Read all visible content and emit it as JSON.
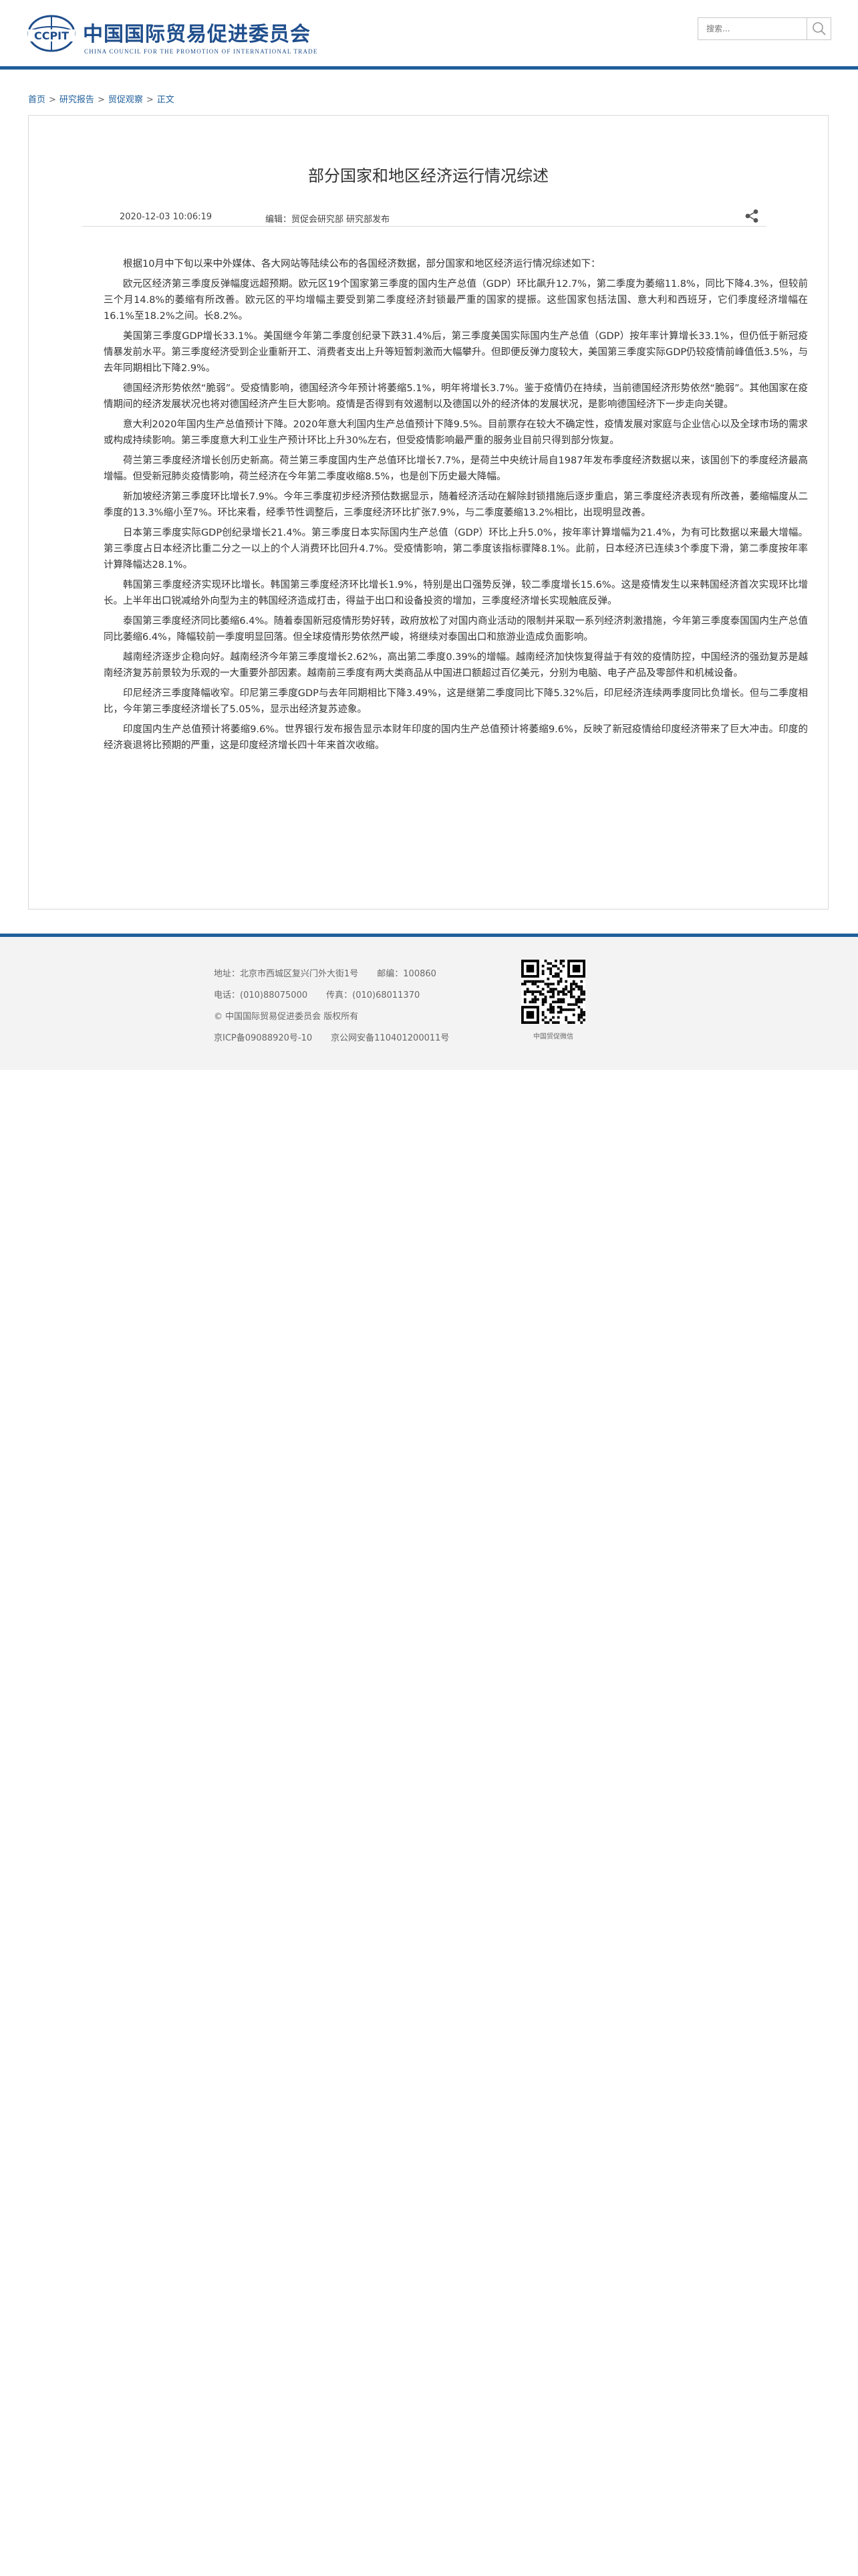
{
  "header": {
    "logo": {
      "mark_text": "CCPIT",
      "name_cn": "中国国际贸易促进委员会",
      "name_en": "CHINA COUNCIL FOR THE PROMOTION OF INTERNATIONAL TRADE"
    },
    "search": {
      "placeholder": "搜索...",
      "icon": "search-icon"
    },
    "accent_color": "#1f5f9b"
  },
  "breadcrumb": {
    "items": [
      "首页",
      "研究报告",
      "贸促观察",
      "正文"
    ],
    "separator": ">"
  },
  "article": {
    "title": "部分国家和地区经济运行情况综述",
    "date": "2020-12-03 10:06:19",
    "editor": "编辑：贸促会研究部 研究部发布",
    "share_icon": "share-icon",
    "paragraphs": [
      "根据10月中下旬以来中外媒体、各大网站等陆续公布的各国经济数据，部分国家和地区经济运行情况综述如下：",
      "欧元区经济第三季度反弹幅度远超预期。欧元区19个国家第三季度的国内生产总值（GDP）环比飙升12.7%，第二季度为萎缩11.8%，同比下降4.3%，但较前三个月14.8%的萎缩有所改善。欧元区的平均增幅主要受到第二季度经济封锁最严重的国家的提振。这些国家包括法国、意大利和西班牙，它们季度经济增幅在16.1%至18.2%之间。长8.2%。",
      "美国第三季度GDP增长33.1%。美国继今年第二季度创纪录下跌31.4%后，第三季度美国实际国内生产总值（GDP）按年率计算增长33.1%，但仍低于新冠疫情暴发前水平。第三季度经济受到企业重新开工、消费者支出上升等短暂刺激而大幅攀升。但即便反弹力度较大，美国第三季度实际GDP仍较疫情前峰值低3.5%，与去年同期相比下降2.9%。",
      "德国经济形势依然“脆弱”。受疫情影响，德国经济今年预计将萎缩5.1%，明年将增长3.7%。鉴于疫情仍在持续，当前德国经济形势依然“脆弱”。其他国家在疫情期间的经济发展状况也将对德国经济产生巨大影响。疫情是否得到有效遏制以及德国以外的经济体的发展状况，是影响德国经济下一步走向关键。",
      "意大利2020年国内生产总值预计下降。2020年意大利国内生产总值预计下降9.5%。目前票存在较大不确定性，疫情发展对家庭与企业信心以及全球市场的需求或构成持续影响。第三季度意大利工业生产预计环比上升30%左右，但受疫情影响最严重的服务业目前只得到部分恢复。",
      "荷兰第三季度经济增长创历史新高。荷兰第三季度国内生产总值环比增长7.7%，是荷兰中央统计局自1987年发布季度经济数据以来，该国创下的季度经济最高增幅。但受新冠肺炎疫情影响，荷兰经济在今年第二季度收缩8.5%，也是创下历史最大降幅。",
      "新加坡经济第三季度环比增长7.9%。今年三季度初步经济预估数据显示，随着经济活动在解除封锁措施后逐步重启，第三季度经济表现有所改善，萎缩幅度从二季度的13.3%缩小至7%。环比来看，经季节性调整后，三季度经济环比扩张7.9%，与二季度萎缩13.2%相比，出现明显改善。",
      "日本第三季度实际GDP创纪录增长21.4%。第三季度日本实际国内生产总值（GDP）环比上升5.0%，按年率计算增幅为21.4%，为有可比数据以来最大增幅。第三季度占日本经济比重二分之一以上的个人消费环比回升4.7%。受疫情影响，第二季度该指标骤降8.1%。此前，日本经济已连续3个季度下滑，第二季度按年率计算降幅达28.1%。",
      "韩国第三季度经济实现环比增长。韩国第三季度经济环比增长1.9%，特别是出口强势反弹，较二季度增长15.6%。这是疫情发生以来韩国经济首次实现环比增长。上半年出口锐减给外向型为主的韩国经济造成打击，得益于出口和设备投资的增加，三季度经济增长实现触底反弹。",
      "泰国第三季度经济同比萎缩6.4%。随着泰国新冠疫情形势好转，政府放松了对国内商业活动的限制并采取一系列经济刺激措施，今年第三季度泰国国内生产总值同比萎缩6.4%，降幅较前一季度明显回落。但全球疫情形势依然严峻，将继续对泰国出口和旅游业造成负面影响。",
      "越南经济逐步企稳向好。越南经济今年第三季度增长2.62%，高出第二季度0.39%的增幅。越南经济加快恢复得益于有效的疫情防控，中国经济的强劲复苏是越南经济复苏前景较为乐观的一大重要外部因素。越南前三季度有两大类商品从中国进口额超过百亿美元，分别为电脑、电子产品及零部件和机械设备。",
      "印尼经济三季度降幅收窄。印尼第三季度GDP与去年同期相比下降3.49%，这是继第二季度同比下降5.32%后，印尼经济连续两季度同比负增长。但与二季度相比，今年第三季度经济增长了5.05%，显示出经济复苏迹象。",
      "印度国内生产总值预计将萎缩9.6%。世界银行发布报告显示本财年印度的国内生产总值预计将萎缩9.6%，反映了新冠疫情给印度经济带来了巨大冲击。印度的经济衰退将比预期的严重，这是印度经济增长四十年来首次收缩。"
    ]
  },
  "footer": {
    "address": "地址：北京市西城区复兴门外大街1号",
    "postcode": "邮编：100860",
    "phone": "电话：(010)88075000",
    "fax": "传真：(010)68011370",
    "copyright": "© 中国国际贸易促进委员会 版权所有",
    "icp": "京ICP备09088920号-10",
    "police": "京公网安备110401200011号",
    "qr_label": "中国贸促微信",
    "qr_icon": "qr-code-icon"
  }
}
